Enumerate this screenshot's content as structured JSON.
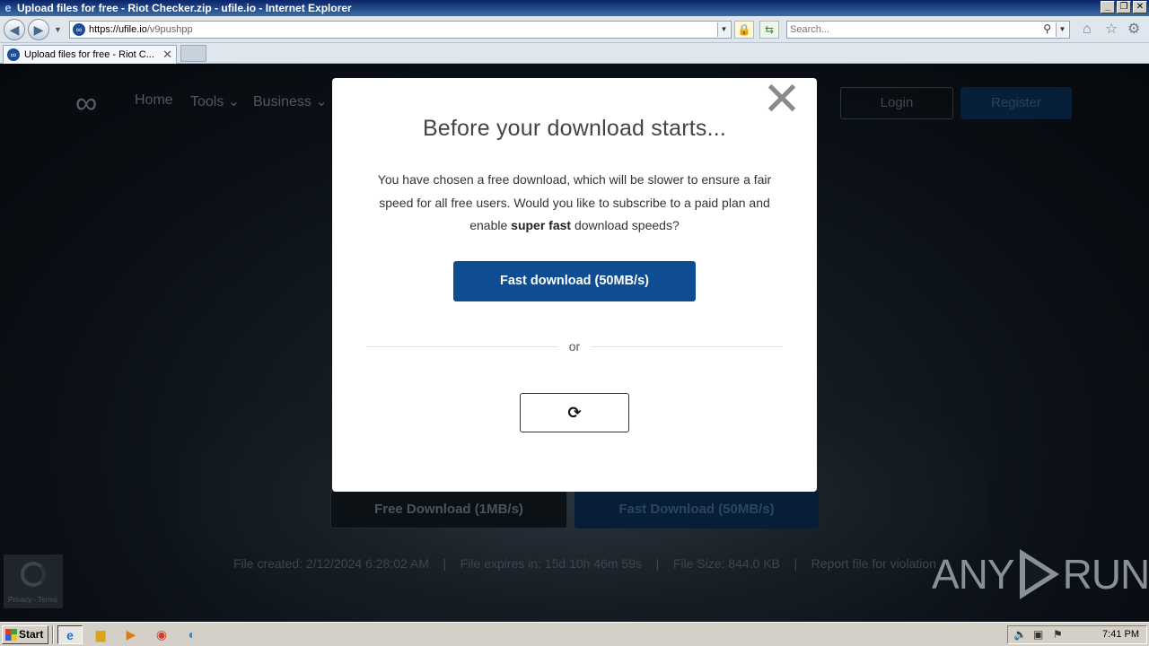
{
  "window": {
    "title": "Upload files for free - Riot Checker.zip - ufile.io - Internet Explorer",
    "minimize": "_",
    "restore": "❐",
    "close": "✕"
  },
  "browser": {
    "url_host": "https://ufile.io",
    "url_path": "/v9pushpp",
    "search_placeholder": "Search...",
    "tab_label": "Upload files for free - Riot C...",
    "tab_close": "✕"
  },
  "site": {
    "nav": [
      "Home",
      "Tools ⌄",
      "Business ⌄"
    ],
    "login": "Login",
    "register": "Register",
    "free_download": "Free Download (1MB/s)",
    "fast_download": "Fast Download (50MB/s)",
    "file_info": {
      "created": "File created: 2/12/2024 6:28:02 AM",
      "expires": "File expires in: 15d 10h 46m 59s",
      "size": "File Size: 844.0 KB",
      "report": "Report file for violation",
      "separator": "|"
    },
    "recaptcha_text": "Privacy - Terms"
  },
  "watermark": {
    "left": "ANY",
    "right": "RUN"
  },
  "modal": {
    "close_symbol": "✕",
    "title": "Before your download starts...",
    "body_pre": "You have chosen a free download, which will be slower to ensure a fair speed for all free users. Would you like to subscribe to a paid plan and enable ",
    "body_bold": "super fast",
    "body_post": " download speeds?",
    "fast_button": "Fast download (50MB/s)",
    "or": "or",
    "loader_symbol": "⟳"
  },
  "taskbar": {
    "start": "Start",
    "clock": "7:41 PM"
  }
}
